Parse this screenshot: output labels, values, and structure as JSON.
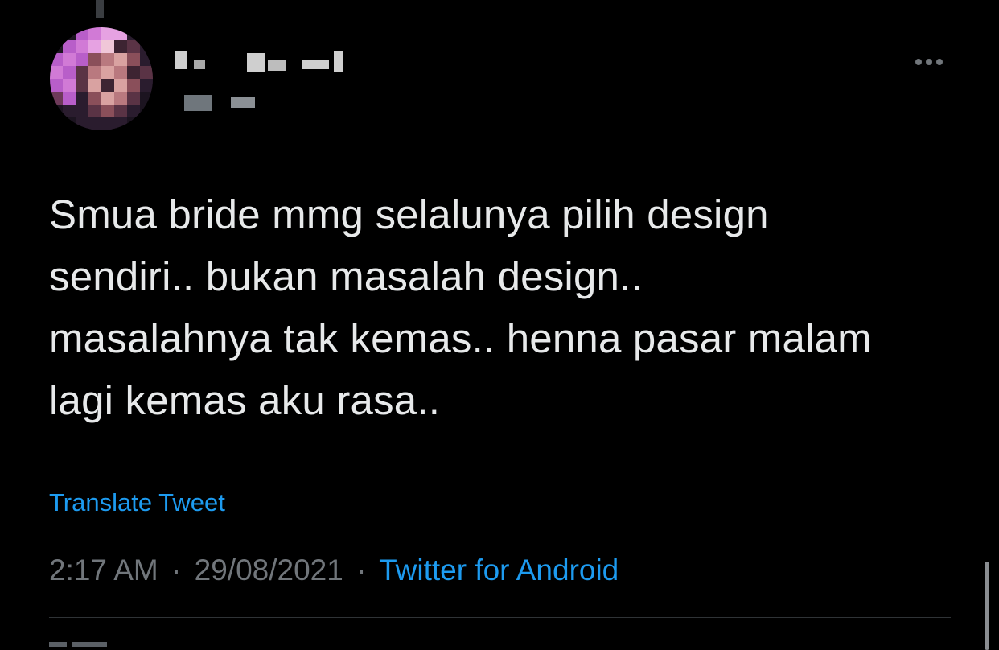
{
  "tweet": {
    "text": "Smua bride mmg selalunya pilih design\nsendiri.. bukan masalah design..\nmasalahnya tak kemas.. henna pasar malam\nlagi kemas aku rasa..",
    "translate_label": "Translate Tweet",
    "time": "2:17 AM",
    "date": "29/08/2021",
    "separator": "·",
    "source": "Twitter for Android",
    "more_icon": "more-horizontal-icon"
  },
  "colors": {
    "background": "#000000",
    "text": "#e7e9ea",
    "secondary": "#71767b",
    "accent": "#1d9bf0",
    "divider": "#2f3336"
  }
}
